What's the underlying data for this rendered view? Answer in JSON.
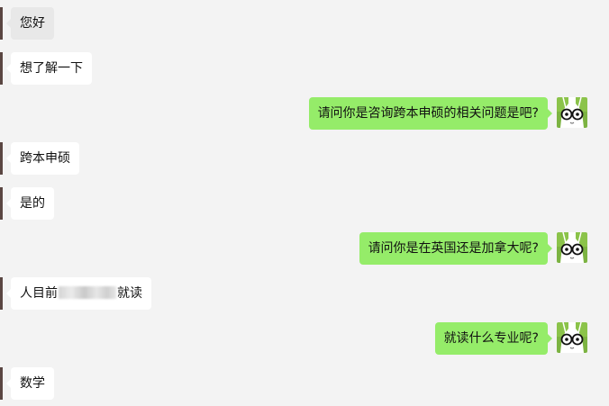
{
  "theme": {
    "background": "#f3f3f3",
    "incoming_bubble": "#ffffff",
    "incoming_bubble_first": "#e8e8e8",
    "outgoing_bubble": "#95ec69"
  },
  "messages": [
    {
      "side": "left",
      "text": "您好"
    },
    {
      "side": "left",
      "text": "想了解一下"
    },
    {
      "side": "right",
      "text": "请问你是咨询跨本申硕的相关问题是吧?"
    },
    {
      "side": "left",
      "text": "跨本申硕"
    },
    {
      "side": "left",
      "text": "是的"
    },
    {
      "side": "right",
      "text": "请问你是在英国还是加拿大呢?"
    },
    {
      "side": "left",
      "text_before": "人目前",
      "text_after": "就读"
    },
    {
      "side": "right",
      "text": "就读什么专业呢?"
    },
    {
      "side": "left",
      "text": "数学"
    }
  ],
  "icons": {
    "agent_avatar": "bunny-with-glasses-icon"
  }
}
